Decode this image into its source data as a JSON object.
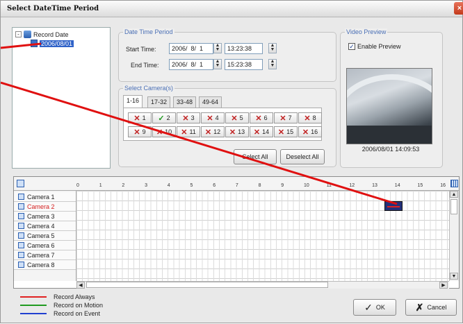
{
  "window": {
    "title": "Select DateTime Period",
    "close_glyph": "×"
  },
  "tree": {
    "root_label": "Record Date",
    "child_label": "2006/08/01",
    "expand_glyph": "-"
  },
  "period": {
    "group_label": "Date Time Period",
    "start_label": "Start Time:",
    "start_date": "2006/  8/  1",
    "start_time": "13:23:38",
    "end_label": "End Time:",
    "end_date": "2006/  8/  1",
    "end_time": "15:23:38"
  },
  "cameras_group": {
    "label": "Select Camera(s)",
    "tabs": [
      "1-16",
      "17-32",
      "33-48",
      "49-64"
    ],
    "cams": [
      {
        "n": "1",
        "state": "off"
      },
      {
        "n": "2",
        "state": "on"
      },
      {
        "n": "3",
        "state": "off"
      },
      {
        "n": "4",
        "state": "off"
      },
      {
        "n": "5",
        "state": "off"
      },
      {
        "n": "6",
        "state": "off"
      },
      {
        "n": "7",
        "state": "off"
      },
      {
        "n": "8",
        "state": "off"
      },
      {
        "n": "9",
        "state": "off"
      },
      {
        "n": "10",
        "state": "off"
      },
      {
        "n": "11",
        "state": "off"
      },
      {
        "n": "12",
        "state": "off"
      },
      {
        "n": "13",
        "state": "off"
      },
      {
        "n": "14",
        "state": "off"
      },
      {
        "n": "15",
        "state": "off"
      },
      {
        "n": "16",
        "state": "off"
      }
    ],
    "select_all": "Select All",
    "deselect_all": "Deselect All"
  },
  "preview": {
    "group_label": "Video Preview",
    "enable_label": "Enable Preview",
    "timestamp": "2006/08/01 14:09:53"
  },
  "timeline": {
    "hours": [
      "0",
      "1",
      "2",
      "3",
      "4",
      "5",
      "6",
      "7",
      "8",
      "9",
      "10",
      "11",
      "12",
      "13",
      "14",
      "15",
      "16"
    ],
    "cameras": [
      "Camera 1",
      "Camera 2",
      "Camera 3",
      "Camera 4",
      "Camera 5",
      "Camera 6",
      "Camera 7",
      "Camera 8"
    ],
    "selected_camera": "Camera 2"
  },
  "legend": [
    {
      "label": "Record Always",
      "color": "#e02020"
    },
    {
      "label": "Record on Motion",
      "color": "#1f9a1f"
    },
    {
      "label": "Record on Event",
      "color": "#2040d0"
    }
  ],
  "buttons": {
    "ok": "OK",
    "cancel": "Cancel"
  }
}
